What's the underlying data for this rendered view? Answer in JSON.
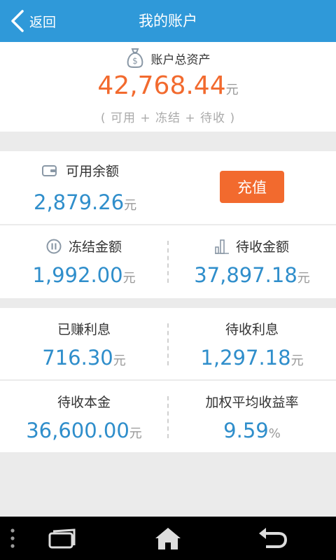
{
  "header": {
    "back_label": "返回",
    "title": "我的账户"
  },
  "summary": {
    "label": "账户总资产",
    "amount": "42,768.44",
    "unit": "元",
    "note": "( 可用 + 冻结 + 待收 )"
  },
  "available": {
    "label": "可用余额",
    "value": "2,879.26",
    "unit": "元",
    "recharge_label": "充值"
  },
  "frozen": {
    "label": "冻结金额",
    "value": "1,992.00",
    "unit": "元"
  },
  "receivable": {
    "label": "待收金额",
    "value": "37,897.18",
    "unit": "元"
  },
  "earned_interest": {
    "label": "已赚利息",
    "value": "716.30",
    "unit": "元"
  },
  "pending_interest": {
    "label": "待收利息",
    "value": "1,297.18",
    "unit": "元"
  },
  "pending_principal": {
    "label": "待收本金",
    "value": "36,600.00",
    "unit": "元"
  },
  "weighted_yield": {
    "label": "加权平均收益率",
    "value": "9.59",
    "unit": "%"
  },
  "colors": {
    "header": "#2f99d9",
    "accent_orange": "#f26a2e",
    "value_blue": "#2f8ecb"
  },
  "icons": [
    "back-arrow-icon",
    "money-bag-icon",
    "wallet-icon",
    "pause-icon",
    "bar-chart-icon",
    "menu-dots-icon",
    "recent-apps-icon",
    "home-icon",
    "return-icon"
  ]
}
